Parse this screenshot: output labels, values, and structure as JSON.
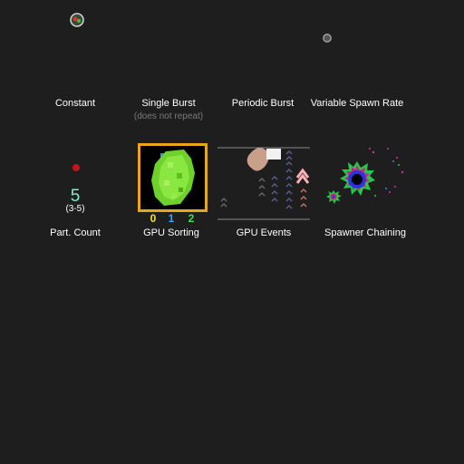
{
  "demos": {
    "constant": {
      "label": "Constant"
    },
    "single_burst": {
      "label": "Single Burst",
      "note": "(does not repeat)"
    },
    "periodic_burst": {
      "label": "Periodic Burst"
    },
    "variable_spawn_rate": {
      "label": "Variable Spawn Rate"
    },
    "part_count": {
      "label": "Part. Count",
      "value": "5",
      "range": "(3-5)"
    },
    "gpu_sorting": {
      "label": "GPU Sorting",
      "indices": [
        {
          "text": "0",
          "color": "#ffe21a"
        },
        {
          "text": "1",
          "color": "#2aa7ff"
        },
        {
          "text": "2",
          "color": "#3ee05a"
        }
      ]
    },
    "gpu_events": {
      "label": "GPU Events"
    },
    "spawner_chaining": {
      "label": "Spawner Chaining"
    }
  },
  "colors": {
    "background": "#1e1e1e",
    "sort_frame": "#e6a817",
    "particle_green": "#7ad83a",
    "count_teal": "#7ef0c8"
  }
}
